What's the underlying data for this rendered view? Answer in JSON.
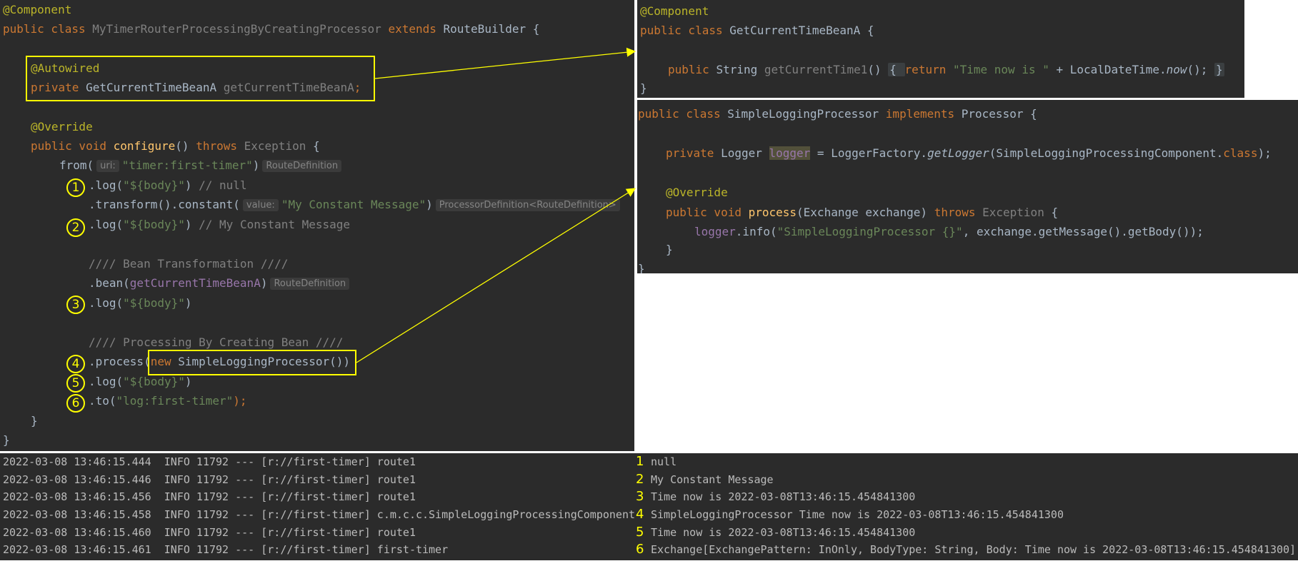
{
  "main_code": {
    "line1": {
      "annotation": "@Component"
    },
    "line2": {
      "kw1": "public class ",
      "class_name": "MyTimerRouterProcessingByCreatingProcessor",
      "kw2": " extends ",
      "parent": "RouteBuilder {"
    },
    "line3": {
      "annotation": "@Autowired"
    },
    "line4": {
      "kw": "private ",
      "type": "GetCurrentTimeBeanA ",
      "field": "getCurrentTimeBeanA",
      "semi": ";"
    },
    "line5": {
      "annotation": "@Override"
    },
    "line6": {
      "kw": "public void ",
      "method": "configure",
      "paren": "() ",
      "kw2": "throws ",
      "exc": "Exception",
      "brace": " {"
    },
    "line7": {
      "call": "from(",
      "hint": "uri:",
      "str": "\"timer:first-timer\"",
      "close": ")",
      "hint2": "RouteDefinition"
    },
    "line8": {
      "call": ".log(",
      "str": "\"${body}\"",
      "close": ") ",
      "comment": "// null"
    },
    "line9": {
      "call": ".transform().constant(",
      "hint": "value:",
      "str": "\"My Constant Message\"",
      "close": ")",
      "hint2": "ProcessorDefinition<RouteDefinition>"
    },
    "line10": {
      "call": ".log(",
      "str": "\"${body}\"",
      "close": ") ",
      "comment": "// My Constant Message"
    },
    "line11": {
      "comment": "//// Bean Transformation ////"
    },
    "line12": {
      "call": ".bean(",
      "field": "getCurrentTimeBeanA",
      "close": ")",
      "hint": "RouteDefinition"
    },
    "line13": {
      "call": ".log(",
      "str": "\"${body}\"",
      "close": ")"
    },
    "line14": {
      "comment": "//// Processing By Creating Bean ////"
    },
    "line15": {
      "call": ".process(",
      "kw": "new ",
      "ctor": "SimpleLoggingProcessor()",
      "close": ")"
    },
    "line16": {
      "call": ".log(",
      "str": "\"${body}\"",
      "close": ")"
    },
    "line17": {
      "call": ".to(",
      "str": "\"log:first-timer\"",
      "close": ");"
    },
    "line18": "}",
    "line19": "}"
  },
  "badges": [
    "1",
    "2",
    "3",
    "4",
    "5",
    "6"
  ],
  "bean_code": {
    "line1": {
      "annotation": "@Component"
    },
    "line2": {
      "kw": "public class ",
      "name": "GetCurrentTimeBeanA {"
    },
    "line3": {
      "kw": "public ",
      "type": "String ",
      "method": "getCurrentTime1",
      "paren": "() ",
      "open": "{ ",
      "kw2": "return ",
      "str": "\"Time now is \"",
      "plus": " + LocalDateTime.",
      "now": "now",
      "tail": "(); ",
      "close": "}"
    },
    "line4": "}"
  },
  "processor_code": {
    "line1": {
      "kw": "public class ",
      "name": "SimpleLoggingProcessor ",
      "kw2": "implements ",
      "iface": "Processor {"
    },
    "line2": {
      "kw": "private ",
      "type": "Logger ",
      "field": "logger",
      "eq": " = LoggerFactory.",
      "method": "getLogger",
      "arg": "(SimpleLoggingProcessingComponent.",
      "cls": "class",
      "end": ");"
    },
    "line3": {
      "annotation": "@Override"
    },
    "line4": {
      "kw": "public void ",
      "method": "process",
      "args": "(Exchange exchange) ",
      "kw2": "throws ",
      "exc": "Exception",
      "brace": " {"
    },
    "line5": {
      "field": "logger",
      "call": ".info(",
      "str": "\"SimpleLoggingProcessor {}\"",
      "rest": ", exchange.getMessage().getBody());"
    },
    "line6": "}",
    "line7": "}"
  },
  "console": {
    "left": [
      "2022-03-08 13:46:15.444  INFO 11792 --- [r://first-timer] route1",
      "2022-03-08 13:46:15.446  INFO 11792 --- [r://first-timer] route1",
      "2022-03-08 13:46:15.456  INFO 11792 --- [r://first-timer] route1",
      "2022-03-08 13:46:15.458  INFO 11792 --- [r://first-timer] c.m.c.c.SimpleLoggingProcessingComponent",
      "2022-03-08 13:46:15.460  INFO 11792 --- [r://first-timer] route1",
      "2022-03-08 13:46:15.461  INFO 11792 --- [r://first-timer] first-timer"
    ],
    "numbers": [
      "1",
      "2",
      "3",
      "4",
      "5",
      "6"
    ],
    "right": [
      "null",
      "My Constant Message",
      "Time now is 2022-03-08T13:46:15.454841300",
      "SimpleLoggingProcessor Time now is 2022-03-08T13:46:15.454841300",
      "Time now is 2022-03-08T13:46:15.454841300",
      "Exchange[ExchangePattern: InOnly, BodyType: String, Body: Time now is 2022-03-08T13:46:15.454841300]"
    ]
  },
  "colors": {
    "highlight": "#ffff00",
    "editor_bg": "#2b2b2b"
  }
}
